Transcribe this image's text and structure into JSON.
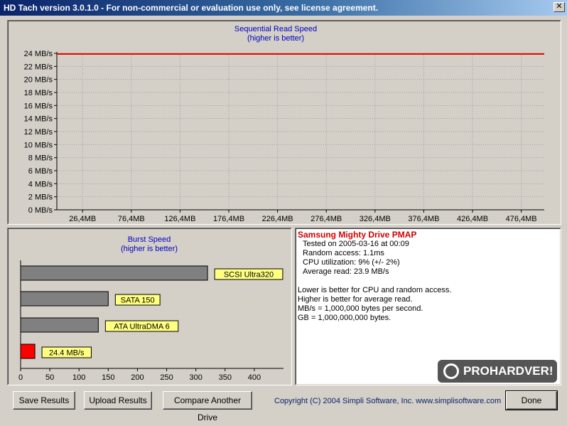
{
  "window": {
    "title": "HD Tach version 3.0.1.0  - For non-commercial or evaluation use only, see license agreement.",
    "close_glyph": "✕"
  },
  "read_chart": {
    "title": "Sequential Read Speed",
    "subtitle": "(higher is better)",
    "line_color": "#e00000"
  },
  "burst_chart": {
    "title": "Burst Speed",
    "subtitle": "(higher is better)",
    "bar_color": "#808080",
    "highlight_color": "#ff0000",
    "label_bg": "#ffff80"
  },
  "chart_data": [
    {
      "type": "line",
      "title": "Sequential Read Speed",
      "subtitle": "(higher is better)",
      "y_tick_labels": [
        "0 MB/s",
        "2 MB/s",
        "4 MB/s",
        "6 MB/s",
        "8 MB/s",
        "10 MB/s",
        "12 MB/s",
        "14 MB/s",
        "16 MB/s",
        "18 MB/s",
        "20 MB/s",
        "22 MB/s",
        "24 MB/s"
      ],
      "x_tick_labels": [
        "26,4MB",
        "76,4MB",
        "126,4MB",
        "176,4MB",
        "226,4MB",
        "276,4MB",
        "326,4MB",
        "376,4MB",
        "426,4MB",
        "476,4MB"
      ],
      "ylim": [
        0,
        24
      ],
      "xlim": [
        0,
        500
      ],
      "grid": true,
      "series": [
        {
          "x": [
            0,
            500
          ],
          "values": [
            23.9,
            23.9
          ]
        }
      ]
    },
    {
      "type": "bar",
      "orientation": "horizontal",
      "title": "Burst Speed",
      "subtitle": "(higher is better)",
      "categories": [
        "SCSI Ultra320",
        "SATA 150",
        "ATA UltraDMA 6",
        "24.4 MB/s"
      ],
      "values": [
        320,
        150,
        133,
        24.4
      ],
      "xlim": [
        0,
        450
      ],
      "x_tick_labels": [
        "0",
        "50",
        "100",
        "150",
        "200",
        "250",
        "300",
        "350",
        "400"
      ]
    }
  ],
  "info": {
    "drive_name": "Samsung Mighty Drive PMAP",
    "tested_on": "Tested on 2005-03-16 at 00:09",
    "random_access": "Random access: 1.1ms",
    "cpu_utilization": "CPU utilization: 9% (+/- 2%)",
    "average_read": "Average read: 23.9 MB/s",
    "note1": "Lower is better for CPU and random access.",
    "note2": "Higher is better for average read.",
    "note3": "MB/s = 1,000,000 bytes per second.",
    "note4": "GB = 1,000,000,000 bytes."
  },
  "logo": {
    "text": "PROHARDVER!"
  },
  "buttons": {
    "save": "Save Results",
    "upload": "Upload Results",
    "compare": "Compare Another Drive",
    "done": "Done"
  },
  "copyright": "Copyright (C) 2004 Simpli Software, Inc. www.simplisoftware.com"
}
